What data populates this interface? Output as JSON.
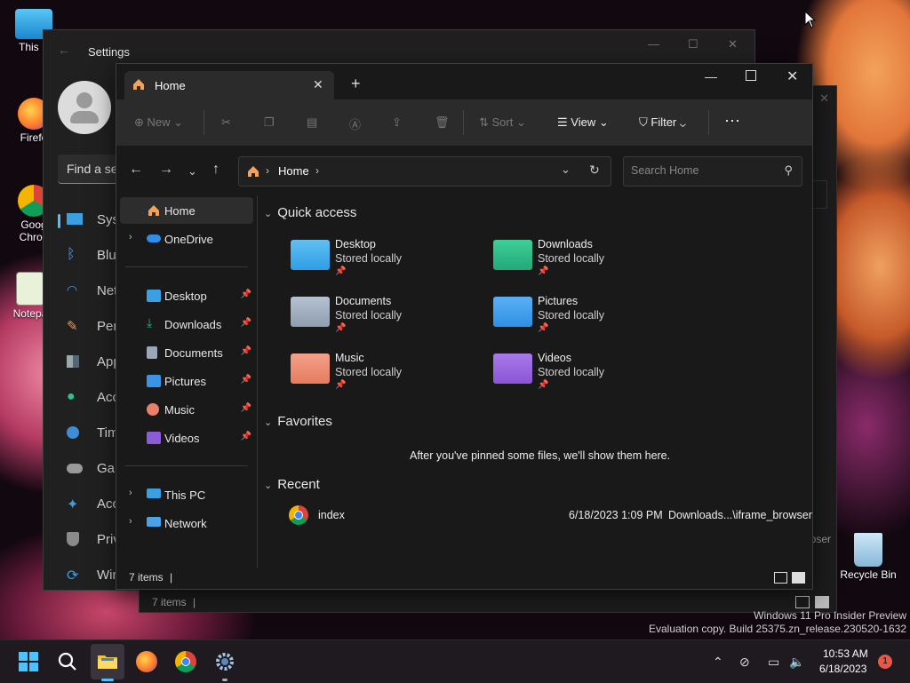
{
  "desktop": {
    "icons": [
      {
        "label": "This P"
      },
      {
        "label": "Firefo"
      },
      {
        "label": "Goog Chron"
      },
      {
        "label": "Notepa"
      },
      {
        "label": "Recycle Bin"
      }
    ],
    "watermark": {
      "line1": "Windows 11 Pro Insider Preview",
      "line2": "Evaluation copy. Build 25375.zn_release.230520-1632"
    }
  },
  "settings": {
    "title": "Settings",
    "search_placeholder": "Find a se",
    "nav": [
      {
        "label": "Syst",
        "icon": "monitor-icon"
      },
      {
        "label": "Blue",
        "icon": "bluetooth-icon"
      },
      {
        "label": "Net",
        "icon": "wifi-icon"
      },
      {
        "label": "Pers",
        "icon": "brush-icon"
      },
      {
        "label": "App",
        "icon": "apps-icon"
      },
      {
        "label": "Acc",
        "icon": "accounts-icon"
      },
      {
        "label": "Tim",
        "icon": "clock-globe-icon"
      },
      {
        "label": "Gan",
        "icon": "gamepad-icon"
      },
      {
        "label": "Acc",
        "icon": "accessibility-icon"
      },
      {
        "label": "Priv",
        "icon": "shield-icon"
      },
      {
        "label": "Win",
        "icon": "update-icon"
      }
    ],
    "behind_text": "bser"
  },
  "explorer_back": {
    "status": "7 items"
  },
  "explorer": {
    "tab": {
      "label": "Home"
    },
    "toolbar": {
      "new_label": "New",
      "sort_label": "Sort",
      "view_label": "View",
      "filter_label": "Filter"
    },
    "address": {
      "crumb": "Home"
    },
    "search_placeholder": "Search Home",
    "sidebar": {
      "top": [
        {
          "label": "Home"
        },
        {
          "label": "OneDrive"
        }
      ],
      "pinned": [
        {
          "label": "Desktop",
          "color": "#3aa0e0"
        },
        {
          "label": "Downloads",
          "color": "#2bb37f"
        },
        {
          "label": "Documents",
          "color": "#9aa7b8"
        },
        {
          "label": "Pictures",
          "color": "#3b93e6"
        },
        {
          "label": "Music",
          "color": "#e8806a"
        },
        {
          "label": "Videos",
          "color": "#8c5bd8"
        }
      ],
      "bottom": [
        {
          "label": "This PC"
        },
        {
          "label": "Network"
        }
      ]
    },
    "quick_access": {
      "title": "Quick access",
      "items": [
        {
          "name": "Desktop",
          "sub": "Stored locally",
          "color": "#2f9ee6"
        },
        {
          "name": "Downloads",
          "sub": "Stored locally",
          "color": "#23a87a"
        },
        {
          "name": "Documents",
          "sub": "Stored locally",
          "color": "#8f9db0"
        },
        {
          "name": "Pictures",
          "sub": "Stored locally",
          "color": "#2f8fe6"
        },
        {
          "name": "Music",
          "sub": "Stored locally",
          "color": "#e67b5f"
        },
        {
          "name": "Videos",
          "sub": "Stored locally",
          "color": "#8a55d6"
        }
      ]
    },
    "favorites": {
      "title": "Favorites",
      "empty_text": "After you've pinned some files, we'll show them here."
    },
    "recent": {
      "title": "Recent",
      "items": [
        {
          "name": "index",
          "date": "6/18/2023 1:09 PM",
          "location": "Downloads...\\iframe_browser"
        }
      ]
    },
    "status": "7 items"
  },
  "taskbar": {
    "time": "10:53 AM",
    "date": "6/18/2023",
    "notifications": "1"
  }
}
